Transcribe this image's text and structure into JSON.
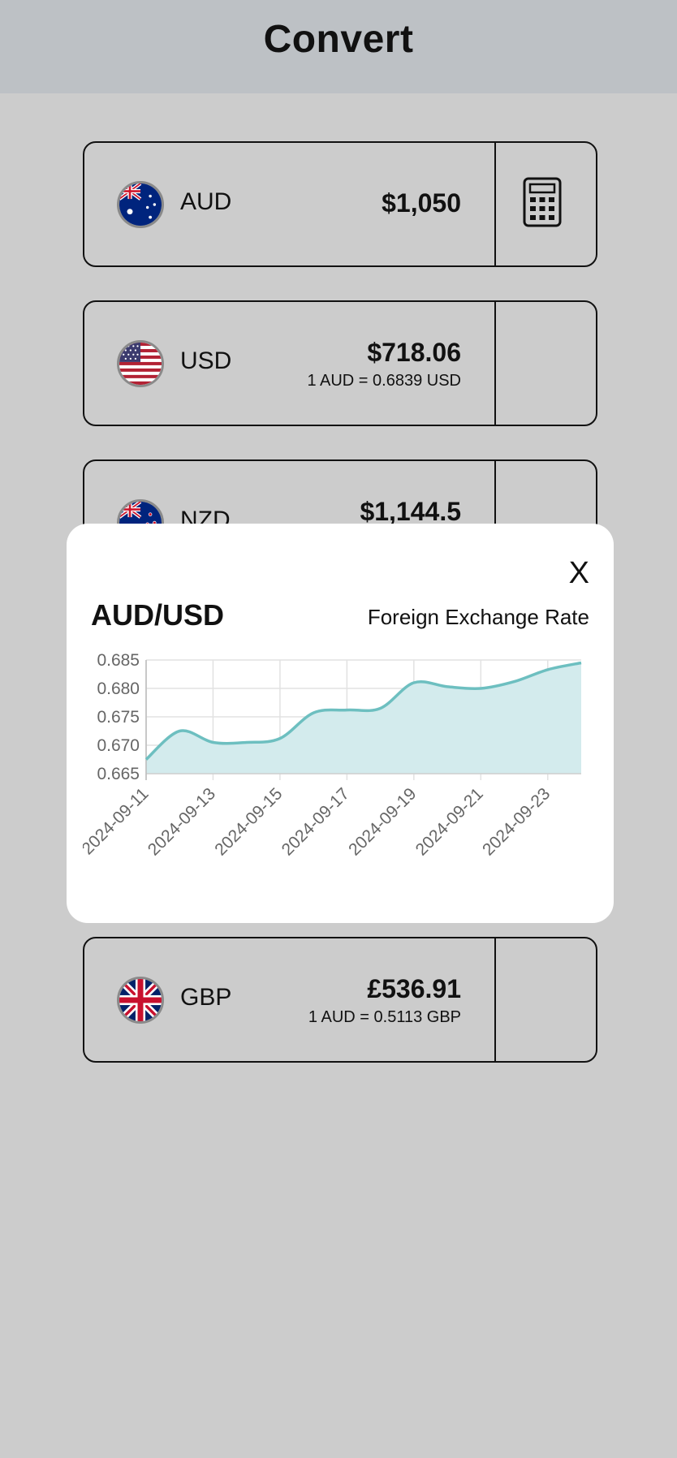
{
  "header": {
    "title": "Convert"
  },
  "cards": [
    {
      "code": "AUD",
      "amount": "$1,050",
      "rate": ""
    },
    {
      "code": "USD",
      "amount": "$718.06",
      "rate": "1 AUD = 0.6839 USD"
    },
    {
      "code": "NZD",
      "amount": "$1,144.5",
      "rate": ""
    },
    {
      "code": "GBP",
      "amount": "£536.91",
      "rate": "1 AUD = 0.5113 GBP"
    }
  ],
  "modal": {
    "close_label": "X",
    "pair": "AUD/USD",
    "subtitle": "Foreign Exchange Rate"
  },
  "colors": {
    "line": "#6dbfc0",
    "fill": "#d3ebed",
    "background": "#cccccc",
    "header": "#bdc1c5"
  },
  "chart_data": {
    "type": "area",
    "x": [
      "2024-09-11",
      "2024-09-12",
      "2024-09-13",
      "2024-09-14",
      "2024-09-15",
      "2024-09-16",
      "2024-09-17",
      "2024-09-18",
      "2024-09-19",
      "2024-09-20",
      "2024-09-21",
      "2024-09-22",
      "2024-09-23",
      "2024-09-24"
    ],
    "y": [
      0.6675,
      0.6725,
      0.6705,
      0.6705,
      0.6712,
      0.6757,
      0.6762,
      0.6765,
      0.681,
      0.6803,
      0.68,
      0.6812,
      0.6833,
      0.6845
    ],
    "x_ticks": [
      "2024-09-11",
      "2024-09-13",
      "2024-09-15",
      "2024-09-17",
      "2024-09-19",
      "2024-09-21",
      "2024-09-23"
    ],
    "y_ticks": [
      "0.665",
      "0.670",
      "0.675",
      "0.680",
      "0.685"
    ],
    "ylim": [
      0.665,
      0.685
    ],
    "grid": true
  }
}
